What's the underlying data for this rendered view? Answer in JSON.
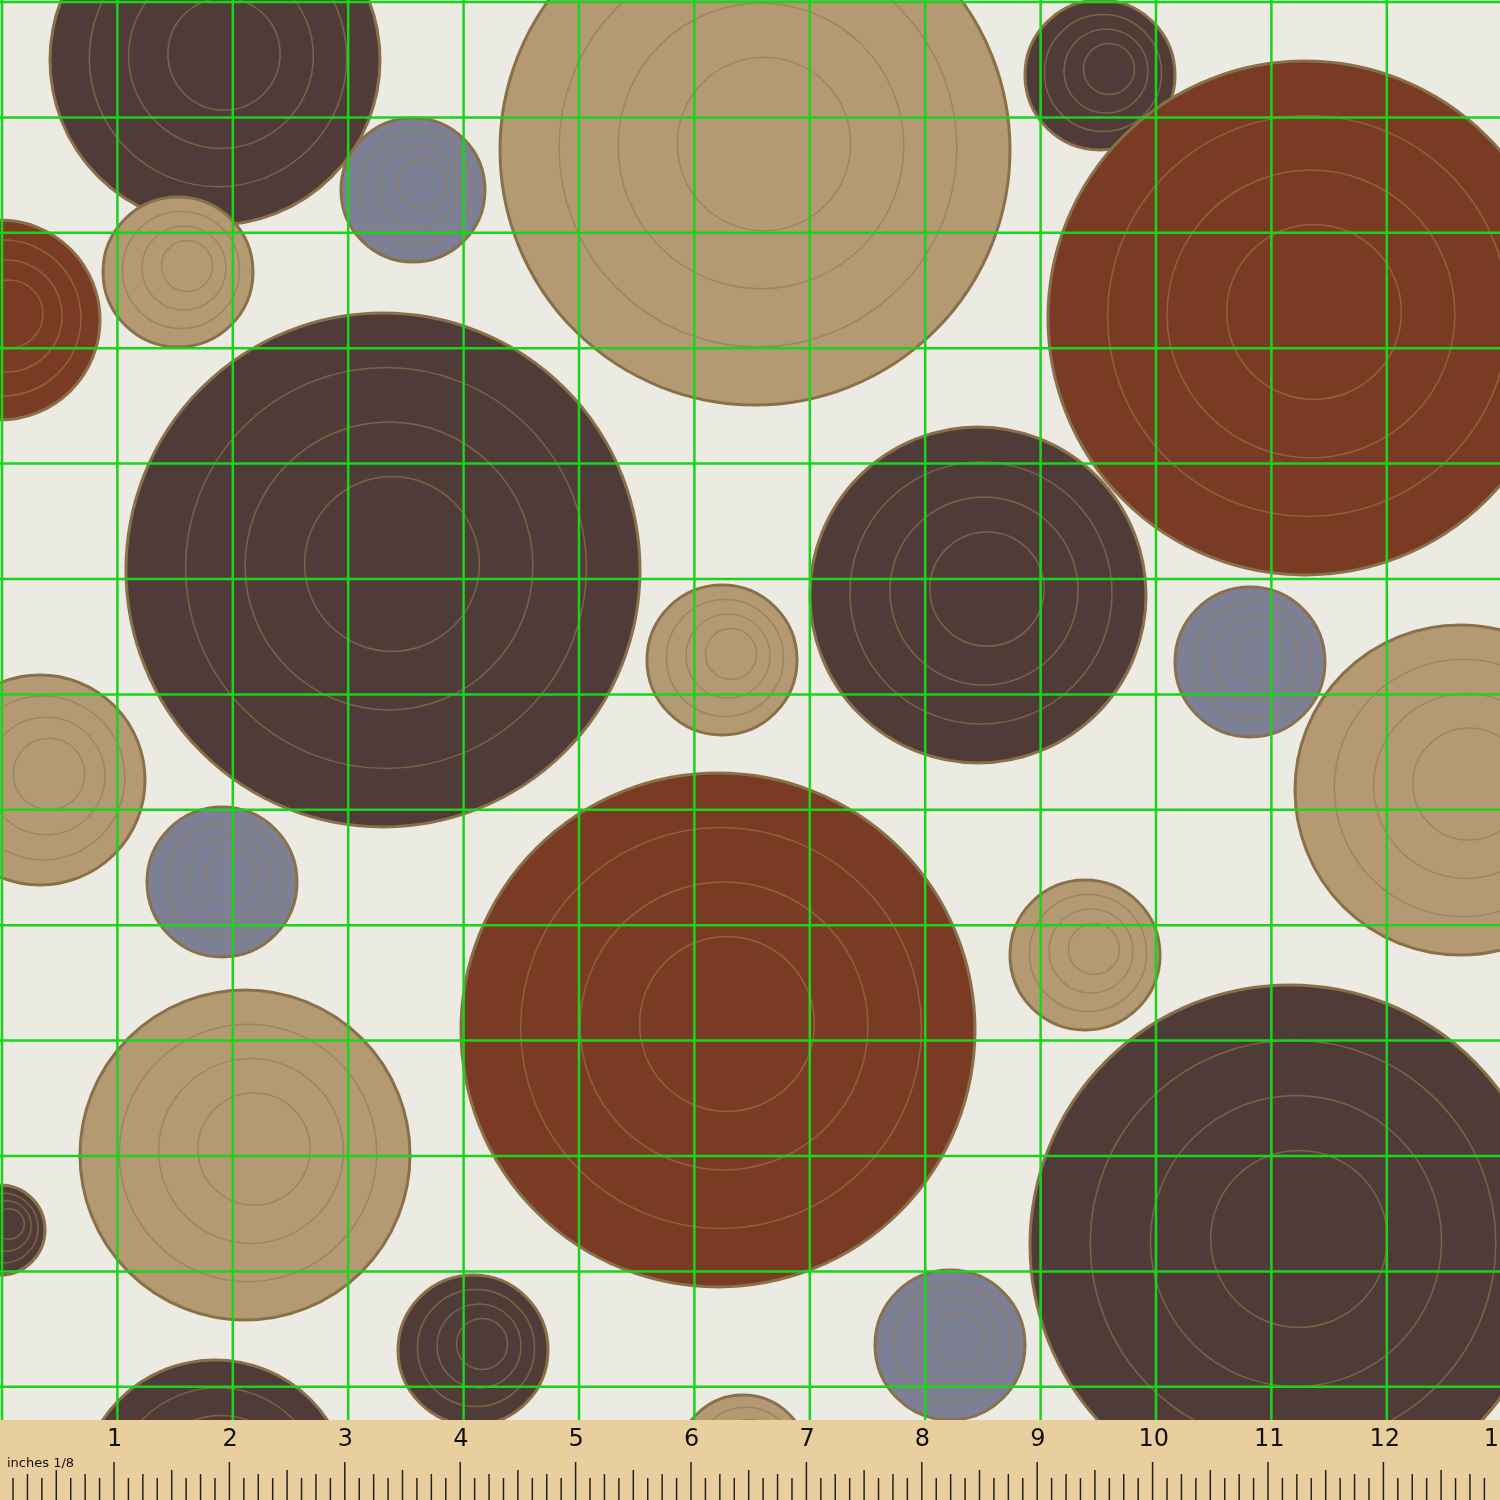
{
  "ruler": {
    "unit_label": "inches 1/8",
    "numbers": [
      "1",
      "2",
      "3",
      "4",
      "5",
      "6",
      "7",
      "8",
      "9",
      "10",
      "11",
      "12",
      "1"
    ]
  }
}
